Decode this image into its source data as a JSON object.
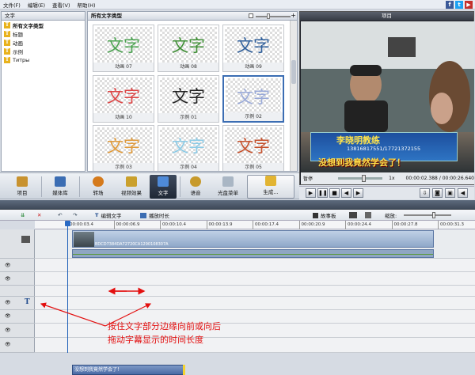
{
  "menu": {
    "items": [
      "文件(F)",
      "编辑(E)",
      "查看(V)",
      "帮助(H)"
    ]
  },
  "left_panel": {
    "title": "文字",
    "items": [
      "所有文字类型",
      "标题",
      "动画",
      "示例",
      "Титры"
    ]
  },
  "gallery": {
    "title": "所有文字类型",
    "tiles": [
      {
        "text": "文字",
        "caption": "动画 07",
        "color": "#4aa24f"
      },
      {
        "text": "文字",
        "caption": "动画 08",
        "color": "#3f8f35"
      },
      {
        "text": "文字",
        "caption": "动画 09",
        "color": "#2e5e9a"
      },
      {
        "text": "文字",
        "caption": "动画 10",
        "color": "#d44"
      },
      {
        "text": "文字",
        "caption": "示例 01",
        "color": "#222"
      },
      {
        "text": "文字",
        "caption": "示例 02",
        "color": "#9aaad8"
      },
      {
        "text": "文字",
        "caption": "示例 03",
        "color": "#e09a3a"
      },
      {
        "text": "文字",
        "caption": "示例 04",
        "color": "#8ccbe6"
      },
      {
        "text": "文字",
        "caption": "示例 05",
        "color": "#c6512c"
      }
    ]
  },
  "preview": {
    "title": "项目",
    "state": "暂停",
    "speed": "1x",
    "time_current": "00:00:02.388",
    "time_total": "00:00:26.640",
    "sub_name": "李晓明教练",
    "sub_phone": "13816817551/17721372155",
    "sub_caption": "没想到我竟然学会了！"
  },
  "toolbar": {
    "buttons": [
      "项目",
      "媒体库",
      "转场",
      "视频效果",
      "文字",
      "语音",
      "光盘菜单",
      "生成..."
    ]
  },
  "timeline": {
    "edit_text": "编辑文字",
    "duration": "播放时长",
    "storyboard": "故事板",
    "zoom": "缩放:",
    "ticks": [
      "00:00:03.4",
      "00:00:06.9",
      "00:00:10.4",
      "00:00:13.9",
      "00:00:17.4",
      "00:00:20.9",
      "00:00:24.4",
      "00:00:27.8",
      "00:00:31.3"
    ],
    "video_clip": "BDCD7384DA72720CA1290108307A",
    "text_clip": "没想到我竟然学会了！"
  },
  "annotation": {
    "line1": "按住文字部分边缘向前或向后",
    "line2": "拖动字幕显示的时间长度"
  },
  "colors": {
    "accent": "#3b6db3",
    "annotation": "#e30f0f",
    "subtitle": "#ffe34a"
  }
}
